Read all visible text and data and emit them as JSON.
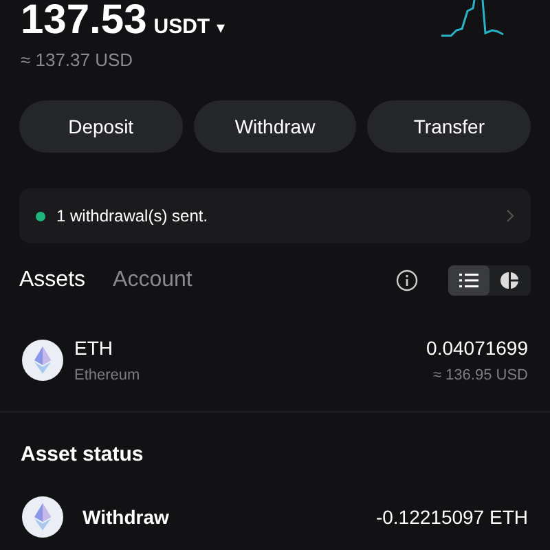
{
  "balance": {
    "amount": "137.53",
    "currency": "USDT",
    "caret": "▾",
    "approx": "≈ 137.37 USD"
  },
  "actions": [
    "Deposit",
    "Withdraw",
    "Transfer"
  ],
  "notice": {
    "text": "1 withdrawal(s) sent.",
    "color": "#1fb57a"
  },
  "tabs": [
    {
      "label": "Assets",
      "selected": true
    },
    {
      "label": "Account",
      "selected": false
    }
  ],
  "view_toggle": [
    {
      "kind": "list",
      "selected": true
    },
    {
      "kind": "pie",
      "selected": false
    }
  ],
  "assets": [
    {
      "symbol": "ETH",
      "name": "Ethereum",
      "amount": "0.04071699",
      "value": "≈ 136.95 USD"
    }
  ],
  "asset_status": {
    "title": "Asset status",
    "items": [
      {
        "label": "Withdraw",
        "amount": "-0.12215097 ETH"
      }
    ]
  }
}
